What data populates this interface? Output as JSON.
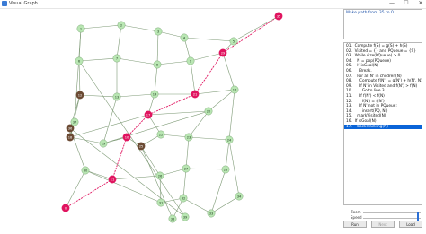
{
  "window": {
    "title": "Visual Graph",
    "minimize_glyph": "—",
    "maximize_glyph": "☐",
    "close_glyph": "✕"
  },
  "message": "Make path from 35 to 0",
  "code_lines": [
    "01.  Compute f(S) = g(S) + h(S)",
    "02.  Visited = {} and PQueue = {S}",
    "03.  While size(PQueue) > 0",
    "04.    N = pop(PQueue)",
    "05.    If isGoal(N)",
    "06.      Break.",
    "07.    For all N' in children(N)",
    "08.      Compute f(N') = g(N') + h(N', N)",
    "09.      If N' in Visited and f(N') > f(N)",
    "10.        Go to line 3",
    "11.      If f(N') < f(N)",
    "12.        f(N') = f(N')",
    "13.      If N' not in PQueue:",
    "14.        insert(PQ, N')",
    "15.    markVisited(N)",
    "16.  If isGoal(N)",
    "17.    backTracking(N)"
  ],
  "selected_line": 16,
  "controls": {
    "zoom_label": "Zoom",
    "speed_label": "Speed",
    "zoom_value": 0.97,
    "speed_value": 0.97,
    "run_label": "Run",
    "next_label": "Next",
    "load_label": "Load"
  },
  "colors": {
    "node_default": "#b9e6b3",
    "node_path": "#e0145f",
    "node_visited": "#6b4a33",
    "edge_default": "#7e9a76",
    "edge_path": "#e0145f",
    "selection": "#0a64d8"
  },
  "graph": {
    "nodes": [
      {
        "id": "0",
        "label": "0",
        "cost": "",
        "state": "path"
      },
      {
        "id": "1",
        "label": "1",
        "cost": "",
        "state": "default"
      },
      {
        "id": "2",
        "label": "2",
        "cost": "",
        "state": "default"
      },
      {
        "id": "3",
        "label": "3",
        "cost": "",
        "state": "default"
      },
      {
        "id": "4",
        "label": "4",
        "cost": "",
        "state": "default"
      },
      {
        "id": "5",
        "label": "5",
        "cost": "",
        "state": "default"
      },
      {
        "id": "6",
        "label": "6",
        "cost": "",
        "state": "default"
      },
      {
        "id": "7",
        "label": "7",
        "cost": "",
        "state": "default"
      },
      {
        "id": "8",
        "label": "8",
        "cost": "",
        "state": "default"
      },
      {
        "id": "9",
        "label": "9",
        "cost": "",
        "state": "default"
      },
      {
        "id": "10",
        "label": "10",
        "cost": "",
        "state": "path"
      },
      {
        "id": "11",
        "label": "11",
        "cost": "",
        "state": "path"
      },
      {
        "id": "12",
        "label": "12",
        "cost": "",
        "state": "visited"
      },
      {
        "id": "13",
        "label": "13",
        "cost": "",
        "state": "default"
      },
      {
        "id": "14",
        "label": "14",
        "cost": "",
        "state": "default"
      },
      {
        "id": "15",
        "label": "15",
        "cost": "",
        "state": "default"
      },
      {
        "id": "16",
        "label": "16",
        "cost": "",
        "state": "default"
      },
      {
        "id": "17",
        "label": "17",
        "cost": "",
        "state": "path"
      },
      {
        "id": "18",
        "label": "18",
        "cost": "",
        "state": "visited"
      },
      {
        "id": "19",
        "label": "19",
        "cost": "",
        "state": "default"
      },
      {
        "id": "20",
        "label": "20",
        "cost": "",
        "state": "default"
      },
      {
        "id": "21",
        "label": "21",
        "cost": "",
        "state": "path"
      },
      {
        "id": "22",
        "label": "22",
        "cost": "",
        "state": "default"
      },
      {
        "id": "23",
        "label": "23",
        "cost": "",
        "state": "default"
      },
      {
        "id": "24",
        "label": "24",
        "cost": "",
        "state": "default"
      },
      {
        "id": "25",
        "label": "25",
        "cost": "",
        "state": "visited"
      },
      {
        "id": "26",
        "label": "26",
        "cost": "",
        "state": "default"
      },
      {
        "id": "27",
        "label": "27",
        "cost": "",
        "state": "default"
      },
      {
        "id": "28",
        "label": "28",
        "cost": "",
        "state": "default"
      },
      {
        "id": "29",
        "label": "29",
        "cost": "",
        "state": "path"
      },
      {
        "id": "30",
        "label": "30",
        "cost": "",
        "state": "default"
      },
      {
        "id": "31",
        "label": "31",
        "cost": "",
        "state": "default"
      },
      {
        "id": "32",
        "label": "32",
        "cost": "",
        "state": "default"
      },
      {
        "id": "33",
        "label": "33",
        "cost": "",
        "state": "default"
      },
      {
        "id": "34",
        "label": "34",
        "cost": "",
        "state": "default"
      },
      {
        "id": "35",
        "label": "35",
        "cost": "",
        "state": "path"
      },
      {
        "id": "36",
        "label": "36",
        "cost": "",
        "state": "visited"
      },
      {
        "id": "37",
        "label": "37",
        "cost": "",
        "state": "default"
      },
      {
        "id": "38",
        "label": "38",
        "cost": "",
        "state": "default"
      },
      {
        "id": "39",
        "label": "39",
        "cost": "",
        "state": "default"
      }
    ],
    "edges": [
      [
        "35",
        "29",
        "path"
      ],
      [
        "29",
        "21",
        "path"
      ],
      [
        "21",
        "17",
        "path"
      ],
      [
        "17",
        "10",
        "path"
      ],
      [
        "10",
        "11",
        "path"
      ],
      [
        "11",
        "0",
        "path"
      ],
      [
        "1",
        "2",
        "default"
      ],
      [
        "2",
        "3",
        "default"
      ],
      [
        "3",
        "4",
        "default"
      ],
      [
        "4",
        "5",
        "default"
      ],
      [
        "5",
        "35",
        "default"
      ],
      [
        "1",
        "6",
        "default"
      ],
      [
        "2",
        "7",
        "default"
      ],
      [
        "3",
        "8",
        "default"
      ],
      [
        "4",
        "9",
        "default"
      ],
      [
        "5",
        "29",
        "default"
      ],
      [
        "6",
        "7",
        "default"
      ],
      [
        "7",
        "8",
        "default"
      ],
      [
        "8",
        "9",
        "default"
      ],
      [
        "9",
        "29",
        "default"
      ],
      [
        "6",
        "12",
        "default"
      ],
      [
        "7",
        "13",
        "default"
      ],
      [
        "8",
        "14",
        "default"
      ],
      [
        "9",
        "21",
        "default"
      ],
      [
        "29",
        "16",
        "default"
      ],
      [
        "12",
        "13",
        "default"
      ],
      [
        "13",
        "14",
        "default"
      ],
      [
        "14",
        "21",
        "default"
      ],
      [
        "21",
        "16",
        "default"
      ],
      [
        "12",
        "18",
        "default"
      ],
      [
        "13",
        "19",
        "default"
      ],
      [
        "14",
        "17",
        "default"
      ],
      [
        "17",
        "20",
        "default"
      ],
      [
        "16",
        "20",
        "default"
      ],
      [
        "18",
        "17",
        "default"
      ],
      [
        "18",
        "19",
        "default"
      ],
      [
        "19",
        "20",
        "default"
      ],
      [
        "17",
        "22",
        "default"
      ],
      [
        "19",
        "10",
        "default"
      ],
      [
        "20",
        "23",
        "default"
      ],
      [
        "16",
        "24",
        "default"
      ],
      [
        "10",
        "25",
        "default"
      ],
      [
        "22",
        "25",
        "default"
      ],
      [
        "22",
        "23",
        "default"
      ],
      [
        "23",
        "24",
        "default"
      ],
      [
        "25",
        "26",
        "default"
      ],
      [
        "11",
        "26",
        "default"
      ],
      [
        "26",
        "27",
        "default"
      ],
      [
        "27",
        "28",
        "default"
      ],
      [
        "23",
        "27",
        "default"
      ],
      [
        "24",
        "28",
        "default"
      ],
      [
        "11",
        "30",
        "default"
      ],
      [
        "30",
        "0",
        "default"
      ],
      [
        "26",
        "31",
        "default"
      ],
      [
        "31",
        "32",
        "default"
      ],
      [
        "27",
        "32",
        "default"
      ],
      [
        "28",
        "33",
        "default"
      ],
      [
        "32",
        "33",
        "default"
      ],
      [
        "30",
        "31",
        "default"
      ],
      [
        "24",
        "34",
        "default"
      ],
      [
        "33",
        "34",
        "default"
      ],
      [
        "36",
        "12",
        "default"
      ],
      [
        "36",
        "18",
        "default"
      ],
      [
        "36",
        "30",
        "default"
      ],
      [
        "37",
        "18",
        "default"
      ],
      [
        "37",
        "1",
        "default"
      ],
      [
        "38",
        "25",
        "default"
      ],
      [
        "38",
        "32",
        "default"
      ],
      [
        "39",
        "6",
        "default"
      ],
      [
        "39",
        "36",
        "default"
      ]
    ]
  }
}
